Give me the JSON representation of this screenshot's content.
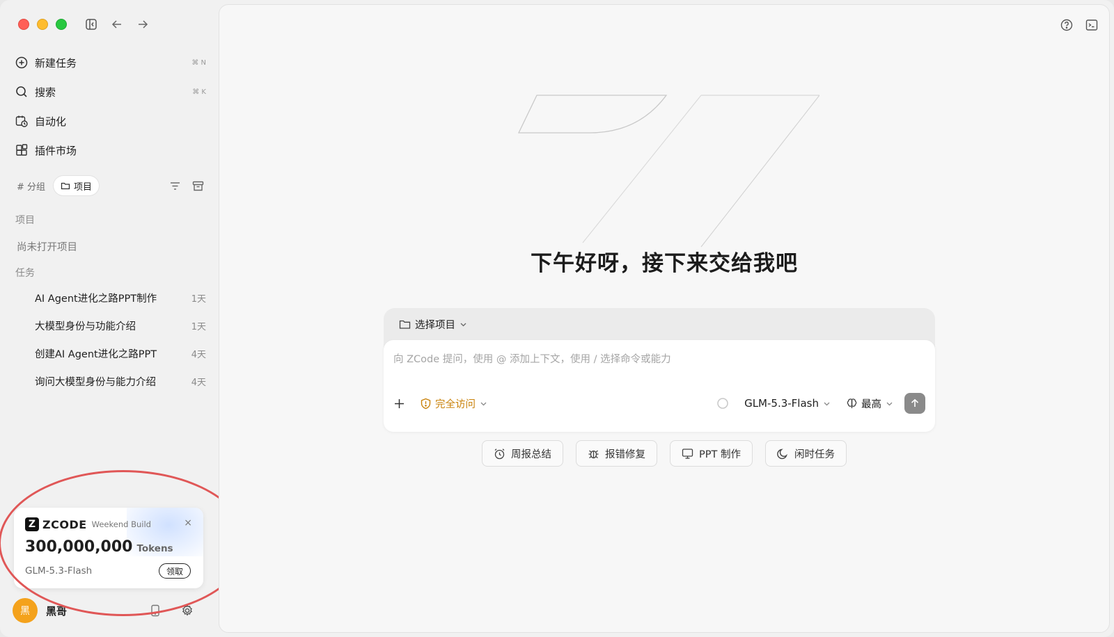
{
  "sidebar": {
    "nav": [
      {
        "label": "新建任务",
        "shortcut": "⌘ N"
      },
      {
        "label": "搜索",
        "shortcut": "⌘ K"
      },
      {
        "label": "自动化",
        "shortcut": ""
      },
      {
        "label": "插件市场",
        "shortcut": ""
      }
    ],
    "segments": {
      "group": "# 分组",
      "project": "项目"
    },
    "projects_label": "项目",
    "no_project": "尚未打开项目",
    "tasks_label": "任务",
    "tasks": [
      {
        "title": "AI Agent进化之路PPT制作",
        "age": "1天"
      },
      {
        "title": "大模型身份与功能介绍",
        "age": "1天"
      },
      {
        "title": "创建AI Agent进化之路PPT",
        "age": "4天"
      },
      {
        "title": "询问大模型身份与能力介绍",
        "age": "4天"
      }
    ],
    "promo": {
      "brand": "ZCODE",
      "subtitle": "Weekend Build",
      "amount": "300,000,000",
      "unit": "Tokens",
      "model": "GLM-5.3-Flash",
      "claim": "领取",
      "close": "×"
    },
    "user": {
      "avatar_text": "黑",
      "name": "黑哥"
    }
  },
  "main": {
    "greeting": "下午好呀，接下来交给我吧",
    "project_select": "选择项目",
    "input_placeholder": "向 ZCode 提问，使用 @ 添加上下文，使用 / 选择命令或能力",
    "permission": "完全访问",
    "model": "GLM-5.3-Flash",
    "level": "最高",
    "quick_actions": [
      "周报总结",
      "报错修复",
      "PPT 制作",
      "闲时任务"
    ]
  },
  "colors": {
    "accent_orange": "#c9820a",
    "avatar": "#f4a21c",
    "annotation": "#e05757"
  }
}
